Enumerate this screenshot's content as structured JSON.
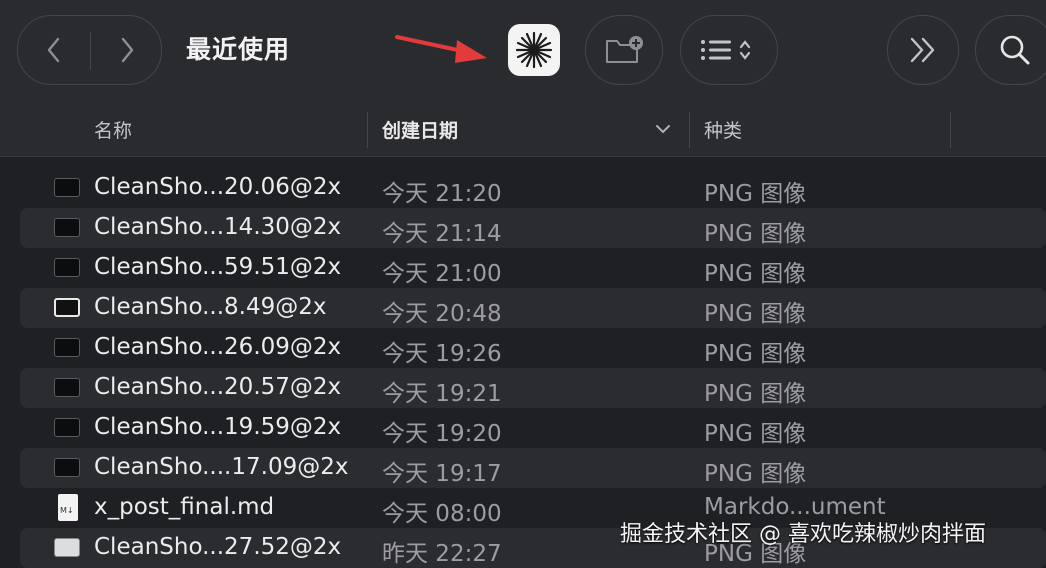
{
  "toolbar": {
    "title": "最近使用"
  },
  "columns": {
    "name": "名称",
    "date": "创建日期",
    "kind": "种类"
  },
  "files": [
    {
      "name": "CleanSho...20.06@2x",
      "date": "今天 21:20",
      "kind": "PNG 图像",
      "thumb": "dark"
    },
    {
      "name": "CleanSho...14.30@2x",
      "date": "今天 21:14",
      "kind": "PNG 图像",
      "thumb": "dark"
    },
    {
      "name": "CleanSho...59.51@2x",
      "date": "今天 21:00",
      "kind": "PNG 图像",
      "thumb": "dark"
    },
    {
      "name": "CleanSho...8.49@2x",
      "date": "今天 20:48",
      "kind": "PNG 图像",
      "thumb": "white"
    },
    {
      "name": "CleanSho...26.09@2x",
      "date": "今天 19:26",
      "kind": "PNG 图像",
      "thumb": "dark"
    },
    {
      "name": "CleanSho...20.57@2x",
      "date": "今天 19:21",
      "kind": "PNG 图像",
      "thumb": "dark"
    },
    {
      "name": "CleanSho...19.59@2x",
      "date": "今天 19:20",
      "kind": "PNG 图像",
      "thumb": "dark"
    },
    {
      "name": "CleanSho....17.09@2x",
      "date": "今天 19:17",
      "kind": "PNG 图像",
      "thumb": "dark"
    },
    {
      "name": "x_post_final.md",
      "date": "今天 08:00",
      "kind": "Markdo...ument",
      "thumb": "doc"
    },
    {
      "name": "CleanSho...27.52@2x",
      "date": "昨天 22:27",
      "kind": "PNG 图像",
      "thumb": "light"
    }
  ],
  "watermark": "掘金技术社区 @ 喜欢吃辣椒炒肉拌面",
  "icons": [
    "chevron-left-icon",
    "chevron-right-icon",
    "red-arrow-icon",
    "starburst-app-icon",
    "new-folder-icon",
    "list-view-icon",
    "double-chevron-right-icon",
    "search-icon",
    "sort-chevron-down-icon"
  ],
  "colors": {
    "background": "#1f2023",
    "toolbar": "#2a2b2e",
    "arrow": "#e23b3b"
  }
}
